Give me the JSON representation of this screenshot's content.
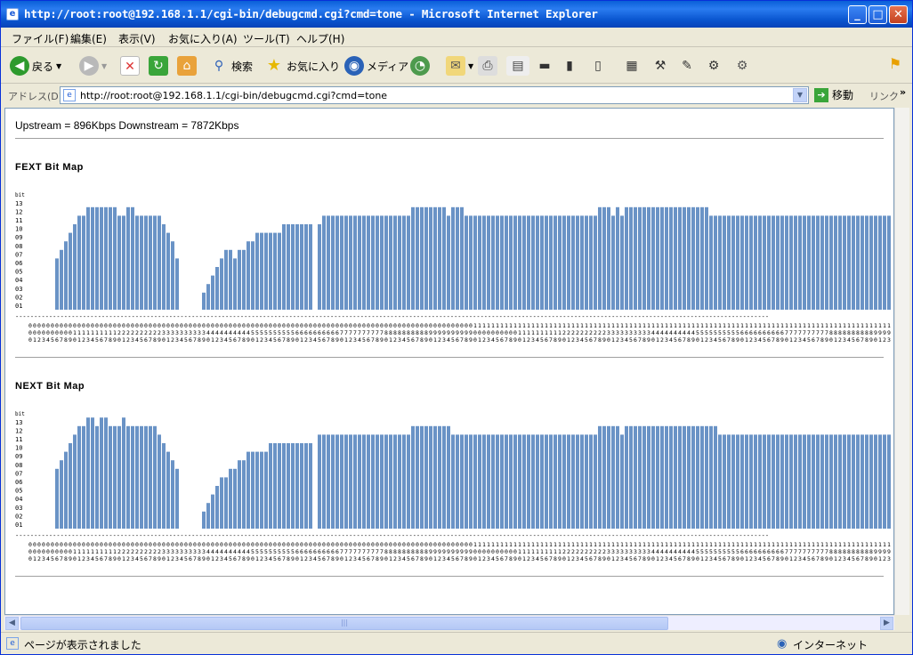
{
  "window": {
    "title": "http://root:root@192.168.1.1/cgi-bin/debugcmd.cgi?cmd=tone - Microsoft Internet Explorer",
    "minimize": "_",
    "maximize": "□",
    "close": "✕"
  },
  "menubar": {
    "items": [
      "ファイル(F)",
      "編集(E)",
      "表示(V)",
      "お気に入り(A)",
      "ツール(T)",
      "ヘルプ(H)"
    ]
  },
  "toolbar": {
    "back_label": "戻る",
    "search_label": "検索",
    "favorites_label": "お気に入り",
    "media_label": "メディア"
  },
  "address": {
    "label": "アドレス(D)",
    "url": "http://root:root@192.168.1.1/cgi-bin/debugcmd.cgi?cmd=tone",
    "go_label": "移動",
    "links_label": "リンク"
  },
  "page": {
    "rate_line": "Upstream = 896Kbps Downstream = 7872Kbps"
  },
  "charts_meta": {
    "bar_color": "#6a93c6",
    "y_tick_labels": [
      "01",
      "02",
      "03",
      "04",
      "05",
      "06",
      "07",
      "08",
      "09",
      "10",
      "11",
      "12",
      "13"
    ],
    "y_axis_label": "bit",
    "dash_line": "---------------------------------------------------------------------------------------------------------------------------------------------------------------------------------------------------------"
  },
  "status": {
    "text": "ページが表示されました",
    "zone": "インターネット"
  },
  "chart_data": [
    {
      "type": "bar",
      "title": "FEXT Bit Map",
      "ylabel": "bit",
      "ylim": [
        0,
        13
      ],
      "x_start": 0,
      "x_end": 194,
      "segments": [
        {
          "from": 6,
          "to": 6,
          "value": 6
        },
        {
          "from": 7,
          "to": 7,
          "value": 7
        },
        {
          "from": 8,
          "to": 8,
          "value": 8
        },
        {
          "from": 9,
          "to": 9,
          "value": 9
        },
        {
          "from": 10,
          "to": 10,
          "value": 10
        },
        {
          "from": 11,
          "to": 12,
          "value": 11
        },
        {
          "from": 13,
          "to": 19,
          "value": 12
        },
        {
          "from": 20,
          "to": 21,
          "value": 11
        },
        {
          "from": 22,
          "to": 23,
          "value": 12
        },
        {
          "from": 24,
          "to": 29,
          "value": 11
        },
        {
          "from": 30,
          "to": 30,
          "value": 10
        },
        {
          "from": 31,
          "to": 31,
          "value": 9
        },
        {
          "from": 32,
          "to": 32,
          "value": 8
        },
        {
          "from": 33,
          "to": 33,
          "value": 6
        },
        {
          "from": 39,
          "to": 39,
          "value": 2
        },
        {
          "from": 40,
          "to": 40,
          "value": 3
        },
        {
          "from": 41,
          "to": 41,
          "value": 4
        },
        {
          "from": 42,
          "to": 42,
          "value": 5
        },
        {
          "from": 43,
          "to": 43,
          "value": 6
        },
        {
          "from": 44,
          "to": 45,
          "value": 7
        },
        {
          "from": 46,
          "to": 46,
          "value": 6
        },
        {
          "from": 47,
          "to": 48,
          "value": 7
        },
        {
          "from": 49,
          "to": 50,
          "value": 8
        },
        {
          "from": 51,
          "to": 56,
          "value": 9
        },
        {
          "from": 57,
          "to": 63,
          "value": 10
        },
        {
          "from": 65,
          "to": 65,
          "value": 10
        },
        {
          "from": 66,
          "to": 67,
          "value": 11
        },
        {
          "from": 68,
          "to": 85,
          "value": 11
        },
        {
          "from": 86,
          "to": 93,
          "value": 12
        },
        {
          "from": 94,
          "to": 94,
          "value": 11
        },
        {
          "from": 95,
          "to": 97,
          "value": 12
        },
        {
          "from": 98,
          "to": 127,
          "value": 11
        },
        {
          "from": 128,
          "to": 130,
          "value": 12
        },
        {
          "from": 131,
          "to": 131,
          "value": 11
        },
        {
          "from": 132,
          "to": 132,
          "value": 12
        },
        {
          "from": 133,
          "to": 133,
          "value": 11
        },
        {
          "from": 134,
          "to": 152,
          "value": 12
        },
        {
          "from": 153,
          "to": 194,
          "value": 11
        }
      ]
    },
    {
      "type": "bar",
      "title": "NEXT Bit Map",
      "ylabel": "bit",
      "ylim": [
        0,
        13
      ],
      "x_start": 0,
      "x_end": 194,
      "segments": [
        {
          "from": 6,
          "to": 6,
          "value": 7
        },
        {
          "from": 7,
          "to": 7,
          "value": 8
        },
        {
          "from": 8,
          "to": 8,
          "value": 9
        },
        {
          "from": 9,
          "to": 9,
          "value": 10
        },
        {
          "from": 10,
          "to": 10,
          "value": 11
        },
        {
          "from": 11,
          "to": 12,
          "value": 12
        },
        {
          "from": 13,
          "to": 14,
          "value": 13
        },
        {
          "from": 15,
          "to": 15,
          "value": 12
        },
        {
          "from": 16,
          "to": 17,
          "value": 13
        },
        {
          "from": 18,
          "to": 20,
          "value": 12
        },
        {
          "from": 21,
          "to": 21,
          "value": 13
        },
        {
          "from": 22,
          "to": 28,
          "value": 12
        },
        {
          "from": 29,
          "to": 29,
          "value": 11
        },
        {
          "from": 30,
          "to": 30,
          "value": 10
        },
        {
          "from": 31,
          "to": 31,
          "value": 9
        },
        {
          "from": 32,
          "to": 32,
          "value": 8
        },
        {
          "from": 33,
          "to": 33,
          "value": 7
        },
        {
          "from": 39,
          "to": 39,
          "value": 2
        },
        {
          "from": 40,
          "to": 40,
          "value": 3
        },
        {
          "from": 41,
          "to": 41,
          "value": 4
        },
        {
          "from": 42,
          "to": 42,
          "value": 5
        },
        {
          "from": 43,
          "to": 44,
          "value": 6
        },
        {
          "from": 45,
          "to": 46,
          "value": 7
        },
        {
          "from": 47,
          "to": 48,
          "value": 8
        },
        {
          "from": 49,
          "to": 53,
          "value": 9
        },
        {
          "from": 54,
          "to": 56,
          "value": 10
        },
        {
          "from": 57,
          "to": 63,
          "value": 10
        },
        {
          "from": 65,
          "to": 85,
          "value": 11
        },
        {
          "from": 86,
          "to": 94,
          "value": 12
        },
        {
          "from": 95,
          "to": 127,
          "value": 11
        },
        {
          "from": 128,
          "to": 132,
          "value": 12
        },
        {
          "from": 133,
          "to": 133,
          "value": 11
        },
        {
          "from": 134,
          "to": 154,
          "value": 12
        },
        {
          "from": 155,
          "to": 194,
          "value": 11
        }
      ]
    }
  ]
}
